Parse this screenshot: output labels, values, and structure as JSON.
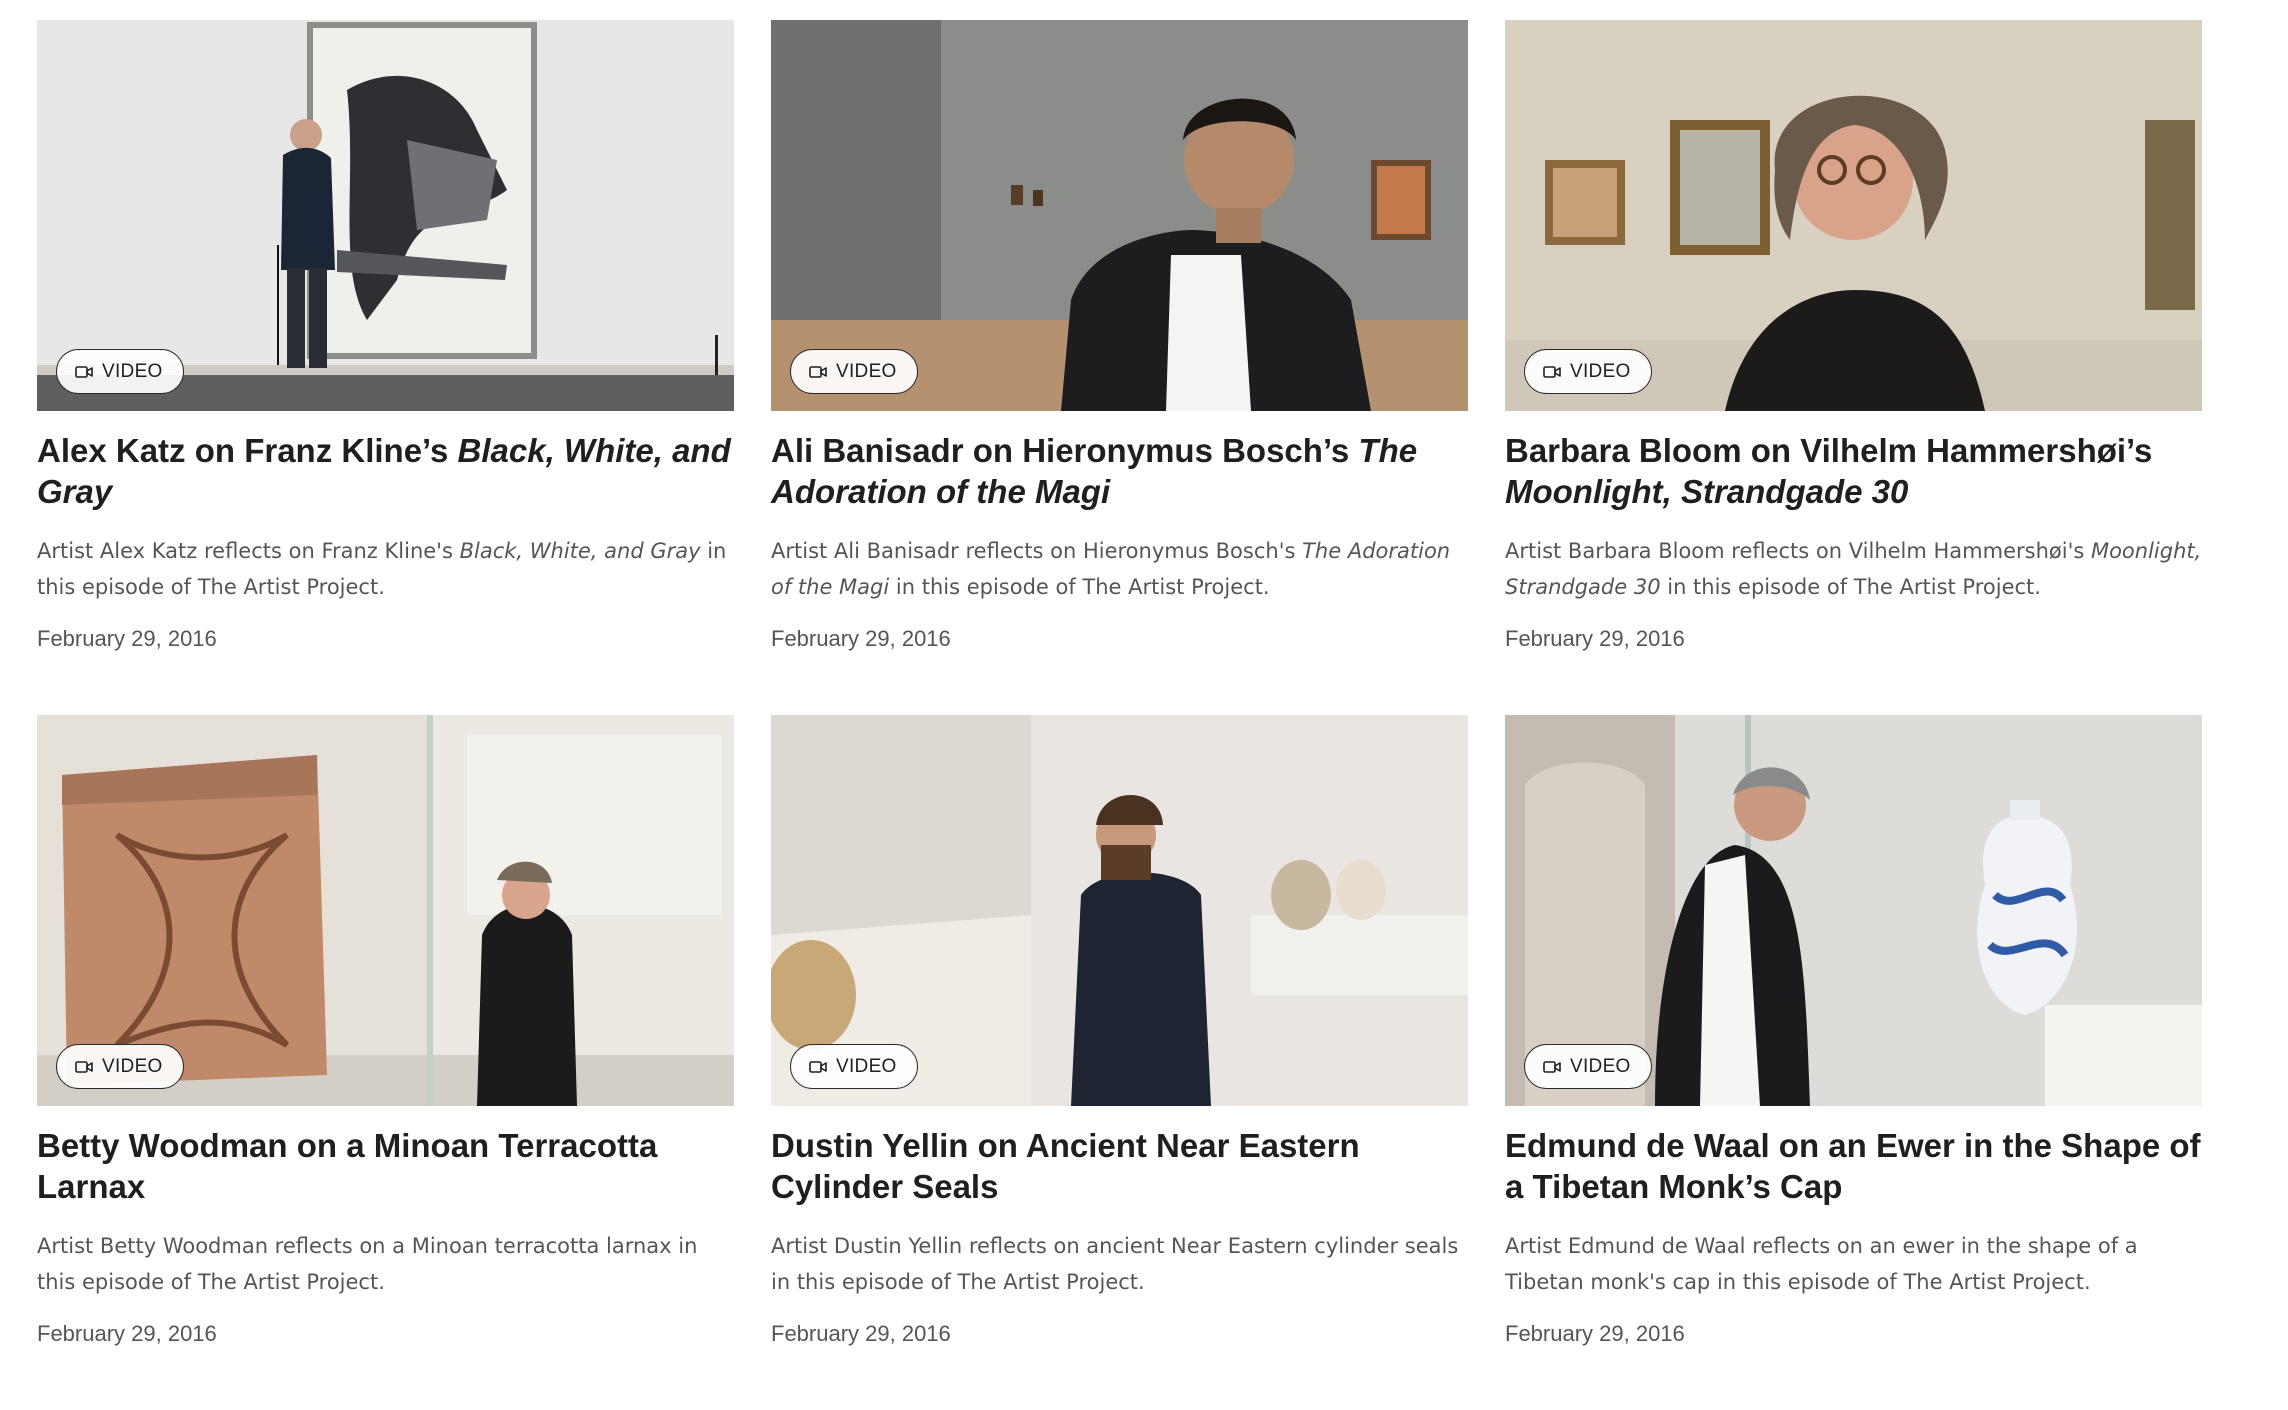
{
  "cards": [
    {
      "badge": "VIDEO",
      "title_plain": "Alex Katz on Franz Kline’s ",
      "title_italic": "Black, White, and Gray",
      "title_after": "",
      "desc_before": "Artist Alex Katz reflects on Franz Kline's ",
      "desc_italic": "Black, White, and Gray",
      "desc_after": " in this episode of The Artist Project.",
      "date": "February 29, 2016"
    },
    {
      "badge": "VIDEO",
      "title_plain": "Ali Banisadr on Hieronymus Bosch’s ",
      "title_italic": "The Adoration of the Magi",
      "title_after": "",
      "desc_before": "Artist Ali Banisadr reflects on Hieronymus Bosch's ",
      "desc_italic": "The Adoration of the Magi",
      "desc_after": " in this episode of The Artist Project.",
      "date": "February 29, 2016"
    },
    {
      "badge": "VIDEO",
      "title_plain": "Barbara Bloom on Vilhelm Hammershøi’s ",
      "title_italic": "Moonlight, Strandgade 30",
      "title_after": "",
      "desc_before": "Artist Barbara Bloom reflects on Vilhelm Hammershøi's ",
      "desc_italic": "Moonlight, Strandgade 30",
      "desc_after": " in this episode of The Artist Project.",
      "date": "February 29, 2016"
    },
    {
      "badge": "VIDEO",
      "title_plain": "Betty Woodman on a Minoan Terracotta Larnax",
      "title_italic": "",
      "title_after": "",
      "desc_before": "Artist Betty Woodman reflects on a Minoan terracotta larnax in this episode of The Artist Project.",
      "desc_italic": "",
      "desc_after": "",
      "date": "February 29, 2016"
    },
    {
      "badge": "VIDEO",
      "title_plain": "Dustin Yellin on Ancient Near Eastern Cylinder Seals",
      "title_italic": "",
      "title_after": "",
      "desc_before": "Artist Dustin Yellin reflects on ancient Near Eastern cylinder seals in this episode of The Artist Project.",
      "desc_italic": "",
      "desc_after": "",
      "date": "February 29, 2016"
    },
    {
      "badge": "VIDEO",
      "title_plain": "Edmund de Waal on an Ewer in the Shape of a Tibetan Monk’s Cap",
      "title_italic": "",
      "title_after": "",
      "desc_before": "Artist Edmund de Waal reflects on an ewer in the shape of a Tibetan monk's cap in this episode of The Artist Project.",
      "desc_italic": "",
      "desc_after": "",
      "date": "February 29, 2016"
    }
  ],
  "colors": {
    "title": "#1f1f1f",
    "body": "#555555",
    "badge_border": "#2a2a2a",
    "background": "#ffffff"
  },
  "icons": {
    "badge": "video-camera-icon"
  }
}
